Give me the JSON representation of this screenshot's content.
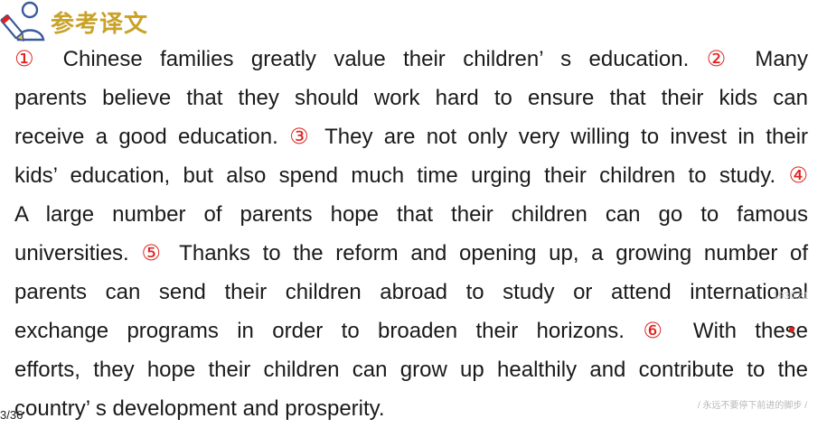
{
  "header": {
    "title": "参考译文",
    "icon": "reader-pencil-icon"
  },
  "lines": [
    {
      "m1": "①",
      "t1": " Chinese families greatly value their children’ s education. ",
      "m2": "②",
      "t2": " Many"
    },
    {
      "t1": "parents believe that they should work hard to ensure that their kids can"
    },
    {
      "t1": "receive a good education. ",
      "m2": "③",
      "t2": " They are not only very willing to invest in their"
    },
    {
      "t1": "kids’  education, but also spend much time urging their children to study. ",
      "m2": "④"
    },
    {
      "t1": "A large number of parents hope that their children can go to famous"
    },
    {
      "t1": "universities. ",
      "m2": "⑤",
      "t2": " Thanks to the reform and opening up, a growing number of"
    },
    {
      "t1": "parents can send their children abroad to study or attend international"
    },
    {
      "t1": "exchange programs in order to broaden their horizons. ",
      "m2": "⑥",
      "t2": "  With these"
    },
    {
      "t1": "efforts, they hope their children can grow up healthily and contribute to the"
    },
    {
      "t1": "country’ s development and prosperity."
    }
  ],
  "footer": {
    "page": "3/36",
    "watermark": "1930:21",
    "motto": "/ 永远不要停下前进的脚步 /"
  },
  "colors": {
    "accent": "#c9a227",
    "marker": "#e0201c",
    "icon": "#3b5a9a"
  }
}
